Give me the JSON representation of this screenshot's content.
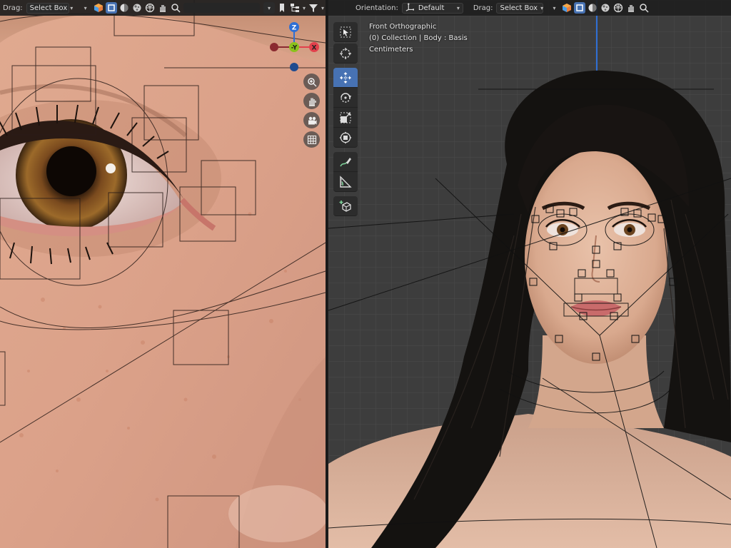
{
  "left_viewport": {
    "header": {
      "drag_label": "Drag:",
      "drag_mode": "Select Box"
    },
    "navigation_axes": {
      "z": "Z",
      "neg_y": "-Y",
      "x": "X"
    }
  },
  "right_viewport": {
    "header": {
      "orientation_label": "Orientation:",
      "orientation_value": "Default",
      "drag_label": "Drag:",
      "drag_mode": "Select Box"
    },
    "info": {
      "view": "Front Orthographic",
      "collection": "(0) Collection | Body : Basis",
      "units": "Centimeters"
    },
    "toolbar": [
      "select-box",
      "cursor",
      "move",
      "rotate",
      "scale",
      "transform",
      "annotate",
      "measure",
      "add-cube"
    ],
    "active_tool": "move"
  },
  "colors": {
    "active": "#4772b3",
    "axis_x": "#e2414c",
    "axis_y": "#8bc21c",
    "axis_z": "#2f6fd4",
    "grid_bg": "#3d3d3d"
  }
}
